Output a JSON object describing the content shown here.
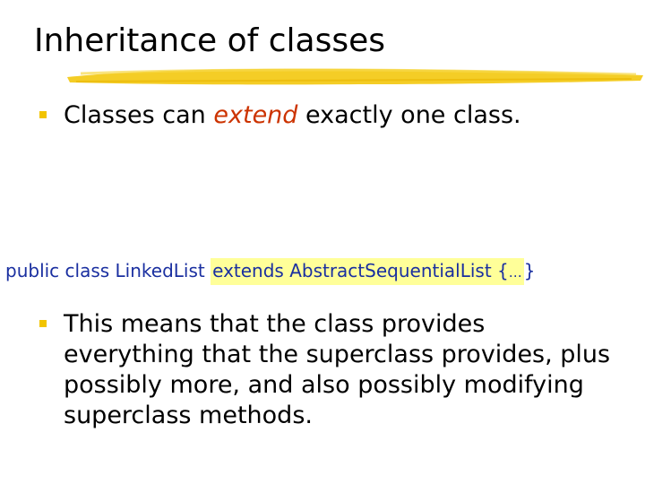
{
  "slide": {
    "title": "Inheritance of classes",
    "bullet1": {
      "prefix": "Classes can ",
      "emphasis": "extend",
      "suffix": " exactly one class."
    },
    "code": {
      "plain": "public class LinkedList ",
      "highlighted": "extends AbstractSequentialList {",
      "ellipsis": "…",
      "close": "}"
    },
    "bullet2": "This means that the class provides everything that the superclass provides, plus possibly more, and also possibly modifying superclass methods."
  },
  "colors": {
    "bullet_marker": "#f2c400",
    "emphasis": "#cc3300",
    "code_text": "#1a2fa0",
    "code_highlight": "#ffff99",
    "title_stroke": "#f2c400"
  }
}
